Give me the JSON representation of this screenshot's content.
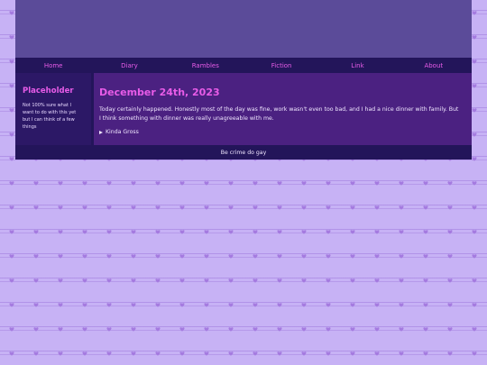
{
  "nav": {
    "items": [
      "Home",
      "Diary",
      "Rambles",
      "Fiction",
      "Link",
      "About"
    ]
  },
  "sidebar": {
    "title": "Placeholder",
    "text": "Not 100% sure what I want to do with this yet but I can think of a few things"
  },
  "post": {
    "title": "December 24th, 2023",
    "body": "Today certainly happened. Honestly most of the day was fine, work wasn't even too bad, and I had a nice dinner with family. But I think something with dinner was really unagreeable with me.",
    "details_summary": "Kinda Gross"
  },
  "footer": {
    "text": "Be crime do gay"
  },
  "colors": {
    "page_background": "#c7b2f5",
    "banner": "#5b4b99",
    "nav_background": "#23155a",
    "accent": "#e85ce8",
    "main_background": "#4b2181",
    "sidebar_background": "#2c1866",
    "heart": "#a57be0"
  },
  "icons": {
    "background_pattern": "heart-icon",
    "details_toggle": "disclosure-triangle-icon"
  }
}
